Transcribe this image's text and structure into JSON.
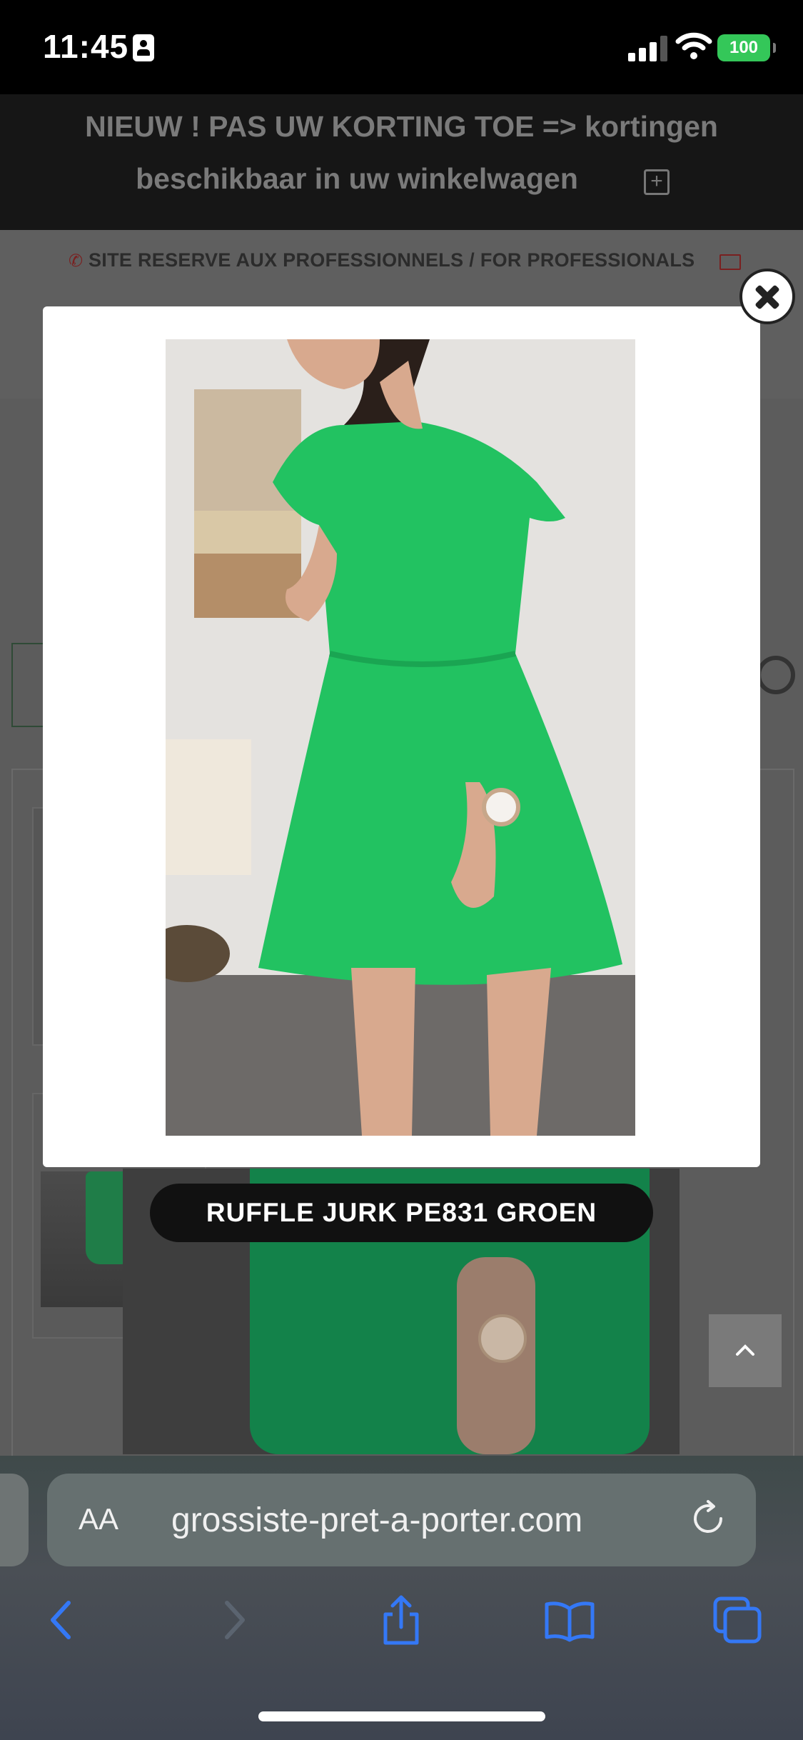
{
  "status_bar": {
    "time": "11:45",
    "battery": "100"
  },
  "banner": {
    "line1": "NIEUW ! PAS UW KORTING TOE => kortingen",
    "line2": "beschikbaar in uw winkelwagen",
    "expand_symbol": "+"
  },
  "subheader": {
    "text": "SITE RESERVE AUX PROFESSIONNELS / FOR PROFESSIONALS"
  },
  "lightbox": {
    "caption": "RUFFLE JURK PE831 GROEN",
    "close_icon": "close-icon"
  },
  "browser": {
    "text_size_label": "AA",
    "url": "grossiste-pret-a-porter.com"
  },
  "colors": {
    "dress_green": "#22c261",
    "battery_green": "#34c759",
    "ios_blue": "#3478f6"
  }
}
